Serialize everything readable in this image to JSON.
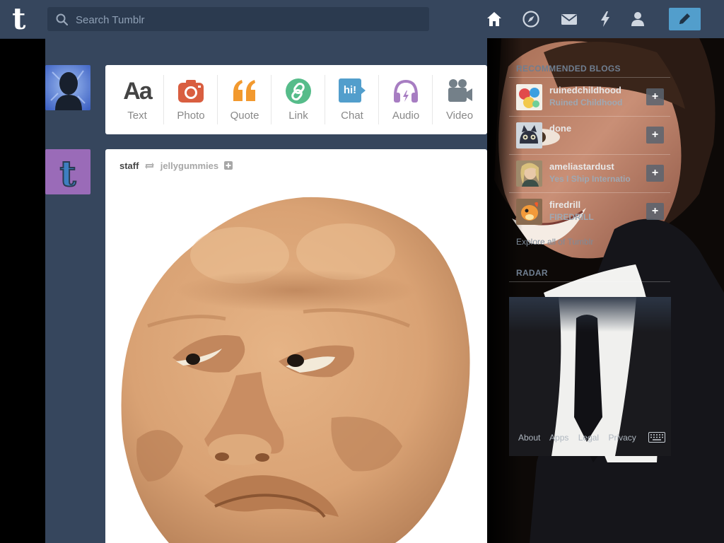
{
  "header": {
    "logo": "t",
    "search_placeholder": "Search Tumblr",
    "nav": [
      "home-icon",
      "explore-compass-icon",
      "inbox-mail-icon",
      "activity-lightning-icon",
      "account-person-icon"
    ],
    "compose_icon": "pencil-icon",
    "accent": "#529ecc",
    "bar_color": "#36465d"
  },
  "post_types": [
    {
      "label": "Text",
      "icon": "Aa",
      "color": "#444444"
    },
    {
      "label": "Photo",
      "icon": "camera-icon",
      "color": "#d95e40"
    },
    {
      "label": "Quote",
      "icon": "quote-icon",
      "color": "#f2992e"
    },
    {
      "label": "Link",
      "icon": "link-icon",
      "color": "#56bc8a"
    },
    {
      "label": "Chat",
      "icon": "hi!",
      "color": "#529ecc"
    },
    {
      "label": "Audio",
      "icon": "headphones-icon",
      "color": "#a77dc2"
    },
    {
      "label": "Video",
      "icon": "video-camera-icon",
      "color": "#748089"
    }
  ],
  "post": {
    "author": "staff",
    "reblog_icon": "reblog-icon",
    "source": "jellygummies",
    "follow_icon": "plus-icon",
    "image": "clay-face-image"
  },
  "sidebar": {
    "recommended_heading": "RECOMMENDED BLOGS",
    "blogs": [
      {
        "name": "ruinedchildhood",
        "title": "Ruined Childhood",
        "follow": "+"
      },
      {
        "name": "done",
        "title": "",
        "follow": "+"
      },
      {
        "name": "ameliastardust",
        "title": "Yes I Ship Internatio",
        "follow": "+"
      },
      {
        "name": "firedrill",
        "title": "FIREDRILL",
        "follow": "+"
      }
    ],
    "explore": "Explore all of Tumblr",
    "radar_heading": "RADAR",
    "footer": [
      "About",
      "Apps",
      "Legal",
      "Privacy"
    ],
    "keyboard_icon": "keyboard-icon"
  }
}
